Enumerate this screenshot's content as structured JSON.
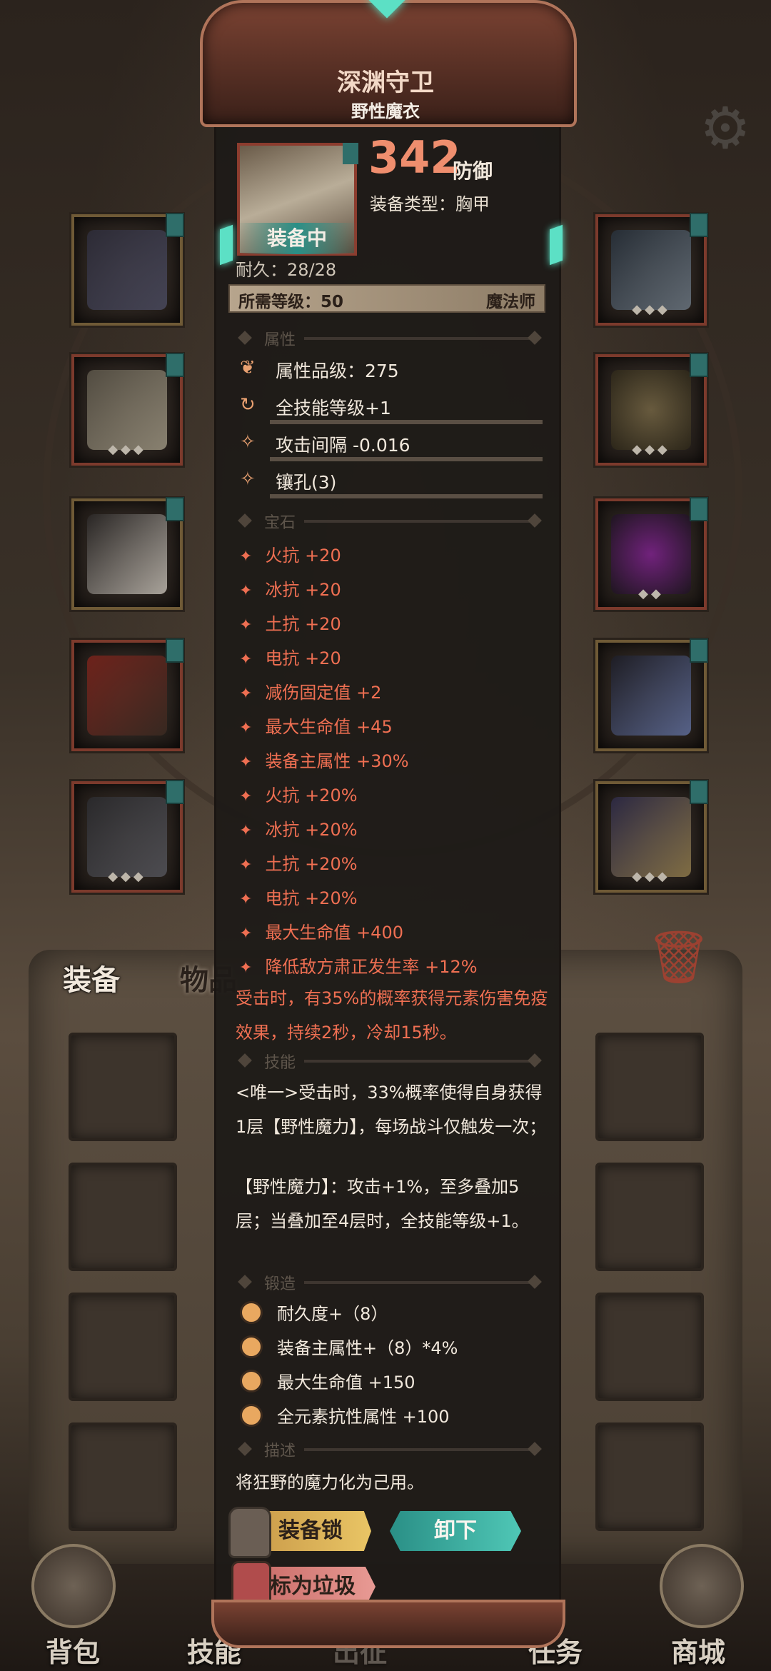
{
  "item": {
    "name": "深渊守卫",
    "subtype": "野性魔衣",
    "equipping_label": "装备中",
    "defense_value": "342",
    "defense_label": "防御",
    "equip_type": "装备类型：胸甲",
    "durability": "耐久：28/28",
    "required_level": "所需等级：50",
    "class": "魔法师"
  },
  "sections": {
    "attributes": "属性",
    "gems": "宝石",
    "skills": "技能",
    "forge": "锻造",
    "description": "描述"
  },
  "attributes": [
    {
      "icon": "lotus-icon",
      "text": "属性品级：275"
    },
    {
      "icon": "cycle-icon",
      "text": "全技能等级+1"
    },
    {
      "icon": "spark-icon",
      "text": "攻击间隔 -0.016"
    },
    {
      "icon": "spark-icon",
      "text": "镶孔(3)"
    }
  ],
  "gem_stats": [
    "火抗 +20",
    "冰抗 +20",
    "土抗 +20",
    "电抗 +20",
    "减伤固定值 +2",
    "最大生命值 +45",
    "装备主属性 +30%",
    "火抗 +20%",
    "冰抗 +20%",
    "土抗 +20%",
    "电抗 +20%",
    "最大生命值 +400",
    "降低敌方肃正发生率 +12%"
  ],
  "gem_effect": "受击时，有35%的概率获得元素伤害免疫效果，持续2秒，冷却15秒。",
  "skill_text_1": "<唯一>受击时，33%概率使得自身获得1层【野性魔力】，每场战斗仅触发一次；",
  "skill_text_2": "【野性魔力】：攻击+1%，至多叠加5层；当叠加至4层时，全技能等级+1。",
  "forge_stats": [
    "耐久度+（8）",
    "装备主属性+（8）*4%",
    "最大生命值 +150",
    "全元素抗性属性 +100"
  ],
  "description_text": "将狂野的魔力化为己用。",
  "buttons": {
    "lock": "装备锁",
    "unequip": "卸下",
    "junk": "标为垃圾"
  },
  "tabs": {
    "equipment": "装备",
    "items": "物品"
  },
  "bottom_nav": [
    "背包",
    "技能",
    "出征",
    "任务",
    "商城"
  ],
  "colors": {
    "accent_red": "#ef6f52",
    "defense": "#ef8e6e",
    "teal": "#2a8f86",
    "gold": "#e9c565"
  }
}
